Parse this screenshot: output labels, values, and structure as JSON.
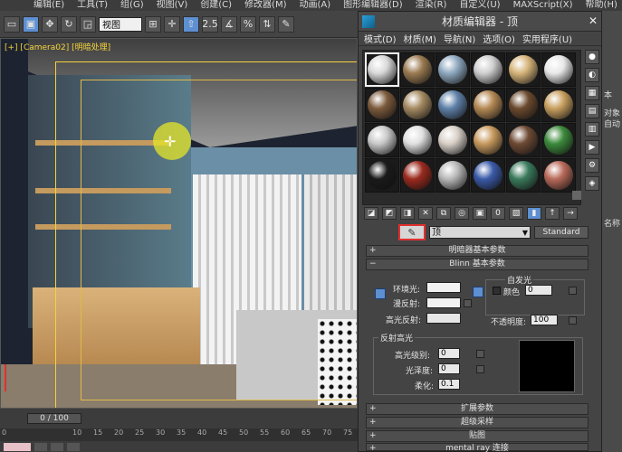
{
  "menubar": {
    "items": [
      "编辑(E)",
      "工具(T)",
      "组(G)",
      "视图(V)",
      "创建(C)",
      "修改器(M)",
      "动画(A)",
      "图形编辑器(D)",
      "渲染(R)",
      "自定义(U)",
      "MAXScript(X)",
      "帮助(H)"
    ]
  },
  "toolbar": {
    "view_select": "视图",
    "snap_label": "2.5",
    "percent_label": "%"
  },
  "viewport": {
    "label_prefix": "[+] [",
    "camera": "Camera02",
    "label_middle": "] [",
    "shading": "明暗处理",
    "label_suffix": "]"
  },
  "timeline": {
    "frame": "0 / 100",
    "ticks": [
      "0",
      "10",
      "15",
      "20",
      "25",
      "30",
      "35",
      "40",
      "45",
      "50",
      "55",
      "60",
      "65",
      "70",
      "75"
    ]
  },
  "material_editor": {
    "title": "材质编辑器 - 顶",
    "menus": [
      "模式(D)",
      "材质(M)",
      "导航(N)",
      "选项(O)",
      "实用程序(U)"
    ],
    "material_name": "顶",
    "material_type": "Standard",
    "rollouts": {
      "shader_basic": "明暗器基本参数",
      "blinn_basic": "Blinn 基本参数",
      "extended": "扩展参数",
      "supersampling": "超级采样",
      "maps": "贴图",
      "mental_ray": "mental ray 连接"
    },
    "blinn": {
      "ambient": "环境光:",
      "diffuse": "漫反射:",
      "specular": "高光反射:",
      "self_illum": "自发光",
      "color": "颜色",
      "color_value": "0",
      "opacity": "不透明度:",
      "opacity_value": "100"
    },
    "spec_highlights": {
      "title": "反射高光",
      "level": "高光级别:",
      "level_value": "0",
      "gloss": "光泽度:",
      "gloss_value": "0",
      "soften": "柔化:",
      "soften_value": "0.1"
    },
    "slot_colors": [
      "#d9d9d9",
      "#9b7b52",
      "#8fa9c0",
      "#cfcfcf",
      "#d6b47a",
      "#e8e8e8",
      "#7c5a3c",
      "#a58a62",
      "#5f80a8",
      "#b58a55",
      "#6b4a2e",
      "#c8a060",
      "#c9c9c9",
      "#e0e0e0",
      "#d8d0c8",
      "#c89a5e",
      "#6e4a34",
      "#3c8a3c",
      "#1a1a1a",
      "#9b2a1e",
      "#b8b8b8",
      "#3a5aa8",
      "#3a7a5c",
      "#b86a5a"
    ],
    "active_slot": 0
  },
  "right_panel": {
    "item1": "本",
    "item2": "对象",
    "item3": "自动",
    "item4": "名称"
  },
  "colors": {
    "accent_blue": "#5d8fd1",
    "highlight_red": "#e23030",
    "frame_yellow": "#f5d23a"
  }
}
